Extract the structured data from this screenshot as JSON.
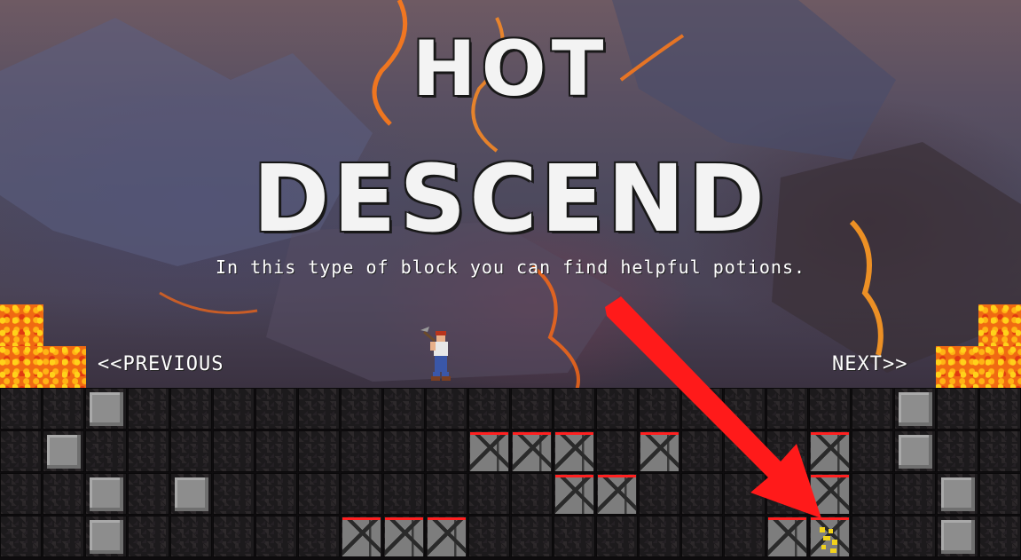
{
  "game": {
    "title_line1": "HOT",
    "title_line2": "DESCEND",
    "hint": "In this type of block you can find helpful potions.",
    "prev_label": "<<PREVIOUS",
    "next_label": "NEXT>>"
  },
  "colors": {
    "lava": "#f06a12",
    "arrow": "#ff1a1a",
    "block_top": "#ff2020"
  }
}
